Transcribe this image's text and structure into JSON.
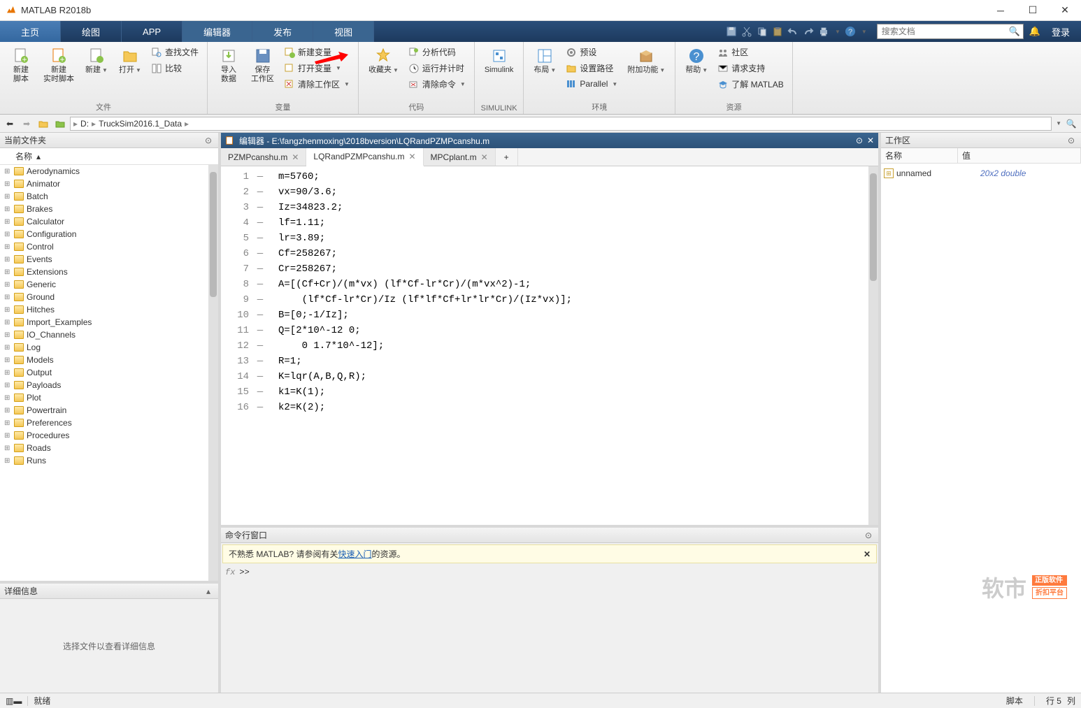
{
  "title": "MATLAB R2018b",
  "tabs": {
    "home": "主页",
    "plots": "绘图",
    "apps": "APP",
    "editor": "编辑器",
    "publish": "发布",
    "view": "视图"
  },
  "search_placeholder": "搜索文档",
  "login": "登录",
  "toolstrip": {
    "file": {
      "newscript": "新建\n脚本",
      "newlivescript": "新建\n实时脚本",
      "new": "新建",
      "open": "打开",
      "findfiles": "查找文件",
      "compare": "比较",
      "label": "文件"
    },
    "variable": {
      "importdata": "导入\n数据",
      "saveworkspace": "保存\n工作区",
      "newvar": "新建变量",
      "openvar": "打开变量",
      "clearworkspace": "清除工作区",
      "label": "变量"
    },
    "code": {
      "favorites": "收藏夹",
      "analyze": "分析代码",
      "runtime": "运行并计时",
      "clearcmd": "清除命令",
      "label": "代码"
    },
    "simulink": {
      "simulink": "Simulink",
      "label": "SIMULINK"
    },
    "env": {
      "layout": "布局",
      "prefs": "预设",
      "setpath": "设置路径",
      "parallel": "Parallel",
      "addons": "附加功能",
      "label": "环境"
    },
    "resources": {
      "help": "帮助",
      "community": "社区",
      "support": "请求支持",
      "learn": "了解 MATLAB",
      "label": "资源"
    }
  },
  "path": {
    "drive": "D:",
    "folder": "TruckSim2016.1_Data"
  },
  "current_folder": {
    "title": "当前文件夹",
    "name_col": "名称",
    "items": [
      "Aerodynamics",
      "Animator",
      "Batch",
      "Brakes",
      "Calculator",
      "Configuration",
      "Control",
      "Events",
      "Extensions",
      "Generic",
      "Ground",
      "Hitches",
      "Import_Examples",
      "IO_Channels",
      "Log",
      "Models",
      "Output",
      "Payloads",
      "Plot",
      "Powertrain",
      "Preferences",
      "Procedures",
      "Roads",
      "Runs"
    ]
  },
  "details": {
    "title": "详细信息",
    "placeholder": "选择文件以查看详细信息"
  },
  "editor": {
    "title": "编辑器 - E:\\fangzhenmoxing\\2018bversion\\LQRandPZMPcanshu.m",
    "tabs": [
      "PZMPcanshu.m",
      "LQRandPZMPcanshu.m",
      "MPCplant.m"
    ],
    "active": 1,
    "lines": [
      "m=5760;",
      "vx=90/3.6;",
      "Iz=34823.2;",
      "lf=1.11;",
      "lr=3.89;",
      "Cf=258267;",
      "Cr=258267;",
      "A=[(Cf+Cr)/(m*vx) (lf*Cf-lr*Cr)/(m*vx^2)-1;",
      "    (lf*Cf-lr*Cr)/Iz (lf*lf*Cf+lr*lr*Cr)/(Iz*vx)];",
      "B=[0;-1/Iz];",
      "Q=[2*10^-12 0;",
      "    0 1.7*10^-12];",
      "R=1;",
      "K=lqr(A,B,Q,R);",
      "k1=K(1);",
      "k2=K(2);"
    ]
  },
  "command_window": {
    "title": "命令行窗口",
    "banner_prefix": "不熟悉 MATLAB? 请参阅有关",
    "banner_link": "快速入门",
    "banner_suffix": "的资源。",
    "prompt": ">>"
  },
  "workspace": {
    "title": "工作区",
    "cols": {
      "name": "名称",
      "value": "值"
    },
    "vars": [
      {
        "name": "unnamed",
        "value": "20x2 double"
      }
    ]
  },
  "status": {
    "ready": "就绪",
    "script": "脚本",
    "line": "行",
    "linenum": "5",
    "col": "列"
  },
  "watermark": {
    "text": "软市",
    "badge1": "正版软件",
    "badge2": "折扣平台"
  }
}
